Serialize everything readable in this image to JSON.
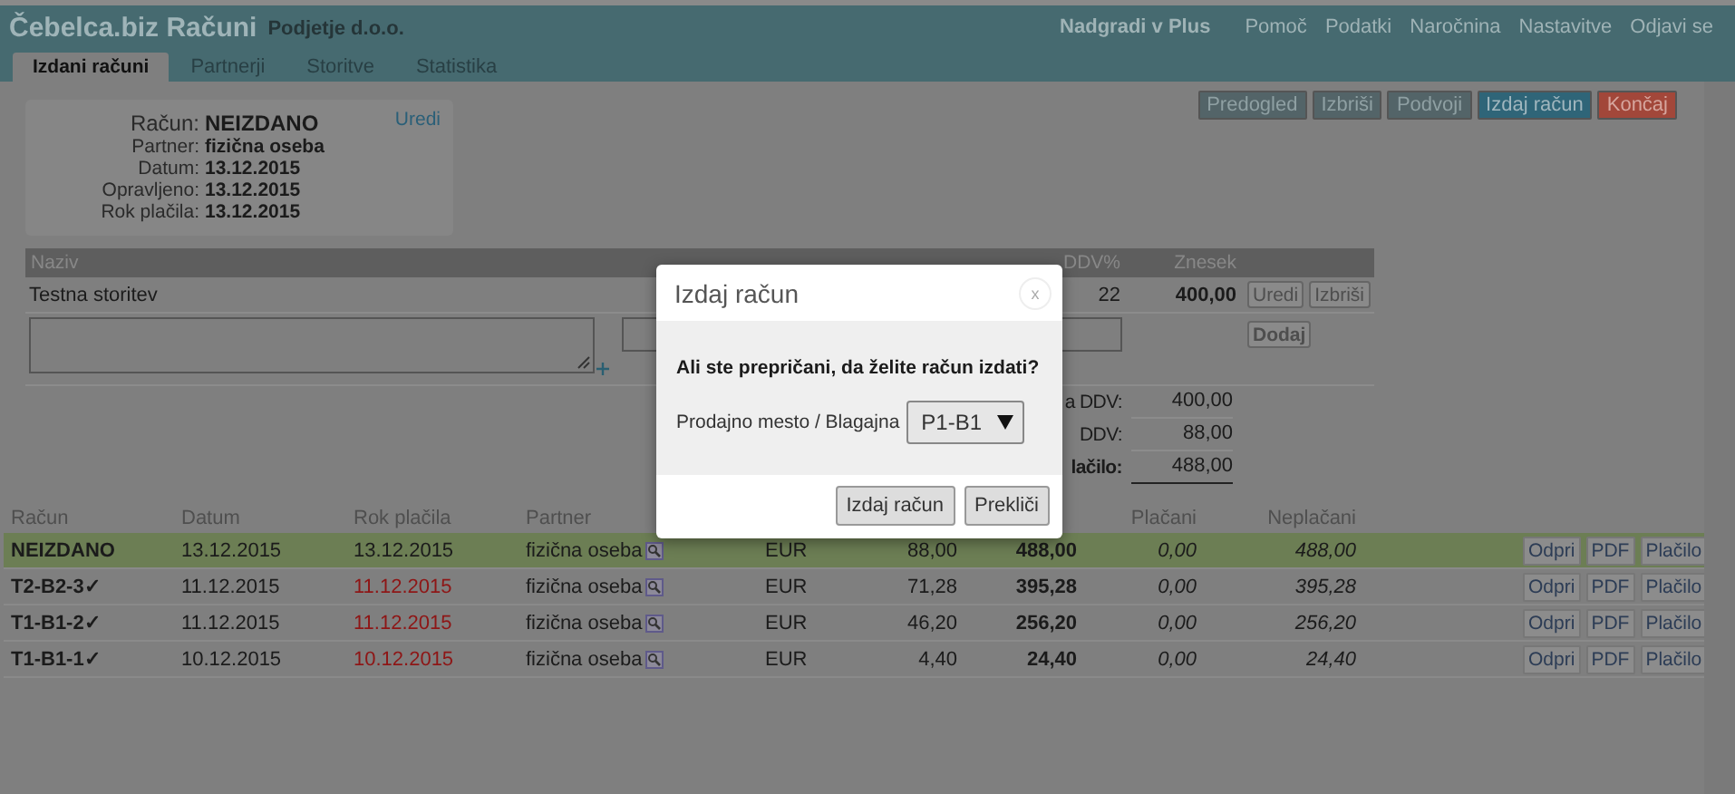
{
  "app": {
    "title": "Čebelca.biz Računi",
    "company": "Podjetje d.o.o."
  },
  "top_nav": [
    {
      "label": "Nadgradi v Plus",
      "kind": "upgrade"
    },
    {
      "label": "Pomoč",
      "kind": "link"
    },
    {
      "label": "Podatki",
      "kind": "link"
    },
    {
      "label": "Naročnina",
      "kind": "link"
    },
    {
      "label": "Nastavitve",
      "kind": "link"
    },
    {
      "label": "Odjavi se",
      "kind": "link"
    }
  ],
  "tabs": [
    {
      "label": "Izdani računi",
      "selected": true
    },
    {
      "label": "Partnerji",
      "selected": false
    },
    {
      "label": "Storitve",
      "selected": false
    },
    {
      "label": "Statistika",
      "selected": false
    }
  ],
  "invoice": {
    "edit_link": "Uredi",
    "fields": [
      {
        "label": "Račun:",
        "value": "NEIZDANO",
        "kind": "title"
      },
      {
        "label": "Partner:",
        "value": "fizična oseba",
        "kind": "field"
      },
      {
        "label": "Datum:",
        "value": "13.12.2015",
        "kind": "field"
      },
      {
        "label": "Opravljeno:",
        "value": "13.12.2015",
        "kind": "field"
      },
      {
        "label": "Rok plačila:",
        "value": "13.12.2015",
        "kind": "field"
      }
    ]
  },
  "actions": [
    {
      "label": "Predogled",
      "kind": "default"
    },
    {
      "label": "Izbriši",
      "kind": "default"
    },
    {
      "label": "Podvoji",
      "kind": "default"
    },
    {
      "label": "Izdaj račun",
      "kind": "primary"
    },
    {
      "label": "Končaj",
      "kind": "danger"
    }
  ],
  "items": {
    "columns": [
      "Naziv",
      "DDV%",
      "Znesek"
    ],
    "rows": [
      {
        "name": "Testna storitev",
        "vat": "22",
        "amount": "400,00",
        "buttons": [
          "Uredi",
          "Izbriši"
        ]
      }
    ],
    "add_button": "Dodaj"
  },
  "totals": [
    {
      "label": "a DDV:",
      "value": "400,00",
      "kind": "sub"
    },
    {
      "label": "DDV:",
      "value": "88,00",
      "kind": "sub"
    },
    {
      "label": "lačilo:",
      "value": "488,00",
      "kind": "total"
    }
  ],
  "invoices": {
    "columns": [
      "Račun",
      "Datum",
      "Rok plačila",
      "Partner",
      "Plačani",
      "Neplačani"
    ],
    "rows": [
      {
        "number": "NEIZDANO",
        "date": "13.12.2015",
        "due": "13.12.2015",
        "overdue": false,
        "partner": "fizična oseba",
        "currency": "EUR",
        "vat": "88,00",
        "total": "488,00",
        "paid": "0,00",
        "unpaid": "488,00",
        "highlighted": true,
        "buttons": [
          "Odpri",
          "PDF",
          "Plačilo"
        ]
      },
      {
        "number": "T2-B2-3✓",
        "date": "11.12.2015",
        "due": "11.12.2015",
        "overdue": true,
        "partner": "fizična oseba",
        "currency": "EUR",
        "vat": "71,28",
        "total": "395,28",
        "paid": "0,00",
        "unpaid": "395,28",
        "highlighted": false,
        "buttons": [
          "Odpri",
          "PDF",
          "Plačilo"
        ]
      },
      {
        "number": "T1-B1-2✓",
        "date": "11.12.2015",
        "due": "11.12.2015",
        "overdue": true,
        "partner": "fizična oseba",
        "currency": "EUR",
        "vat": "46,20",
        "total": "256,20",
        "paid": "0,00",
        "unpaid": "256,20",
        "highlighted": false,
        "buttons": [
          "Odpri",
          "PDF",
          "Plačilo"
        ]
      },
      {
        "number": "T1-B1-1✓",
        "date": "10.12.2015",
        "due": "10.12.2015",
        "overdue": true,
        "partner": "fizična oseba",
        "currency": "EUR",
        "vat": "4,40",
        "total": "24,40",
        "paid": "0,00",
        "unpaid": "24,40",
        "highlighted": false,
        "buttons": [
          "Odpri",
          "PDF",
          "Plačilo"
        ]
      }
    ]
  },
  "dialog": {
    "title": "Izdaj račun",
    "close": "x",
    "question": "Ali ste prepričani, da želite račun izdati?",
    "field_label": "Prodajno mesto / Blagajna",
    "select_value": "P1-B1",
    "buttons": [
      "Izdaj račun",
      "Prekliči"
    ]
  }
}
